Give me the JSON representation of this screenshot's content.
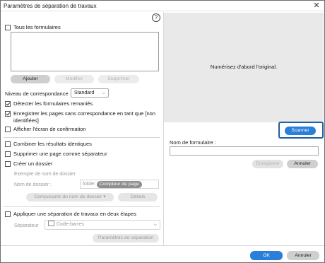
{
  "window": {
    "title": "Paramètres de séparation de travaux",
    "close_glyph": "✕"
  },
  "left": {
    "help_glyph": "?",
    "all_forms": {
      "label": "Tous les formulaires",
      "checked": false
    },
    "form_buttons": {
      "add": "Ajouter",
      "modify": "Modifier",
      "delete": "Supprimer"
    },
    "match_level": {
      "label": "Niveau de correspondance",
      "value": "Standard"
    },
    "options": [
      {
        "key": "detect",
        "label": "Détecter les formulaires remaniés",
        "checked": true
      },
      {
        "key": "save_unmatched_1",
        "label": "Enregistrer les pages sans correspondance en tant que [non",
        "checked": true
      },
      {
        "key": "save_unmatched_2",
        "label": "identifiées]"
      },
      {
        "key": "confirm",
        "label": "Afficher l'écran de confirmation",
        "checked": false
      }
    ],
    "combine": {
      "label": "Combiner les résultats identiques",
      "checked": false
    },
    "delete_sep": {
      "label": "Supprimer une page comme séparateur",
      "checked": false
    },
    "create_folder": {
      "label": "Créer un dossier",
      "checked": false
    },
    "folder_example": {
      "heading": "Exemple de nom de dossier",
      "name_label": "Nom de dossier :",
      "name_value": "folder",
      "name_tag": "Compteur de page",
      "components_button": "Composants du nom de dossier",
      "details_button": "Détails"
    },
    "two_step": {
      "label": "Appliquer une séparation de travaux en deux étapes",
      "checked": false
    },
    "separator": {
      "label": "Séparateur",
      "value": "Code-barres",
      "settings_button": "Paramètres de séparation"
    }
  },
  "right": {
    "preview_message": "Numérisez d'abord l'original.",
    "scan_button": "Scanner",
    "form_name_label": "Nom de formulaire :",
    "form_name_value": "",
    "save_button": "Enregistrer",
    "cancel_button": "Annuler"
  },
  "footer": {
    "ok": "OK",
    "cancel": "Annuler"
  },
  "colors": {
    "accent": "#2b7fd8",
    "highlight_border": "#1f5fa8",
    "preview_bg": "#e9e9e9"
  }
}
